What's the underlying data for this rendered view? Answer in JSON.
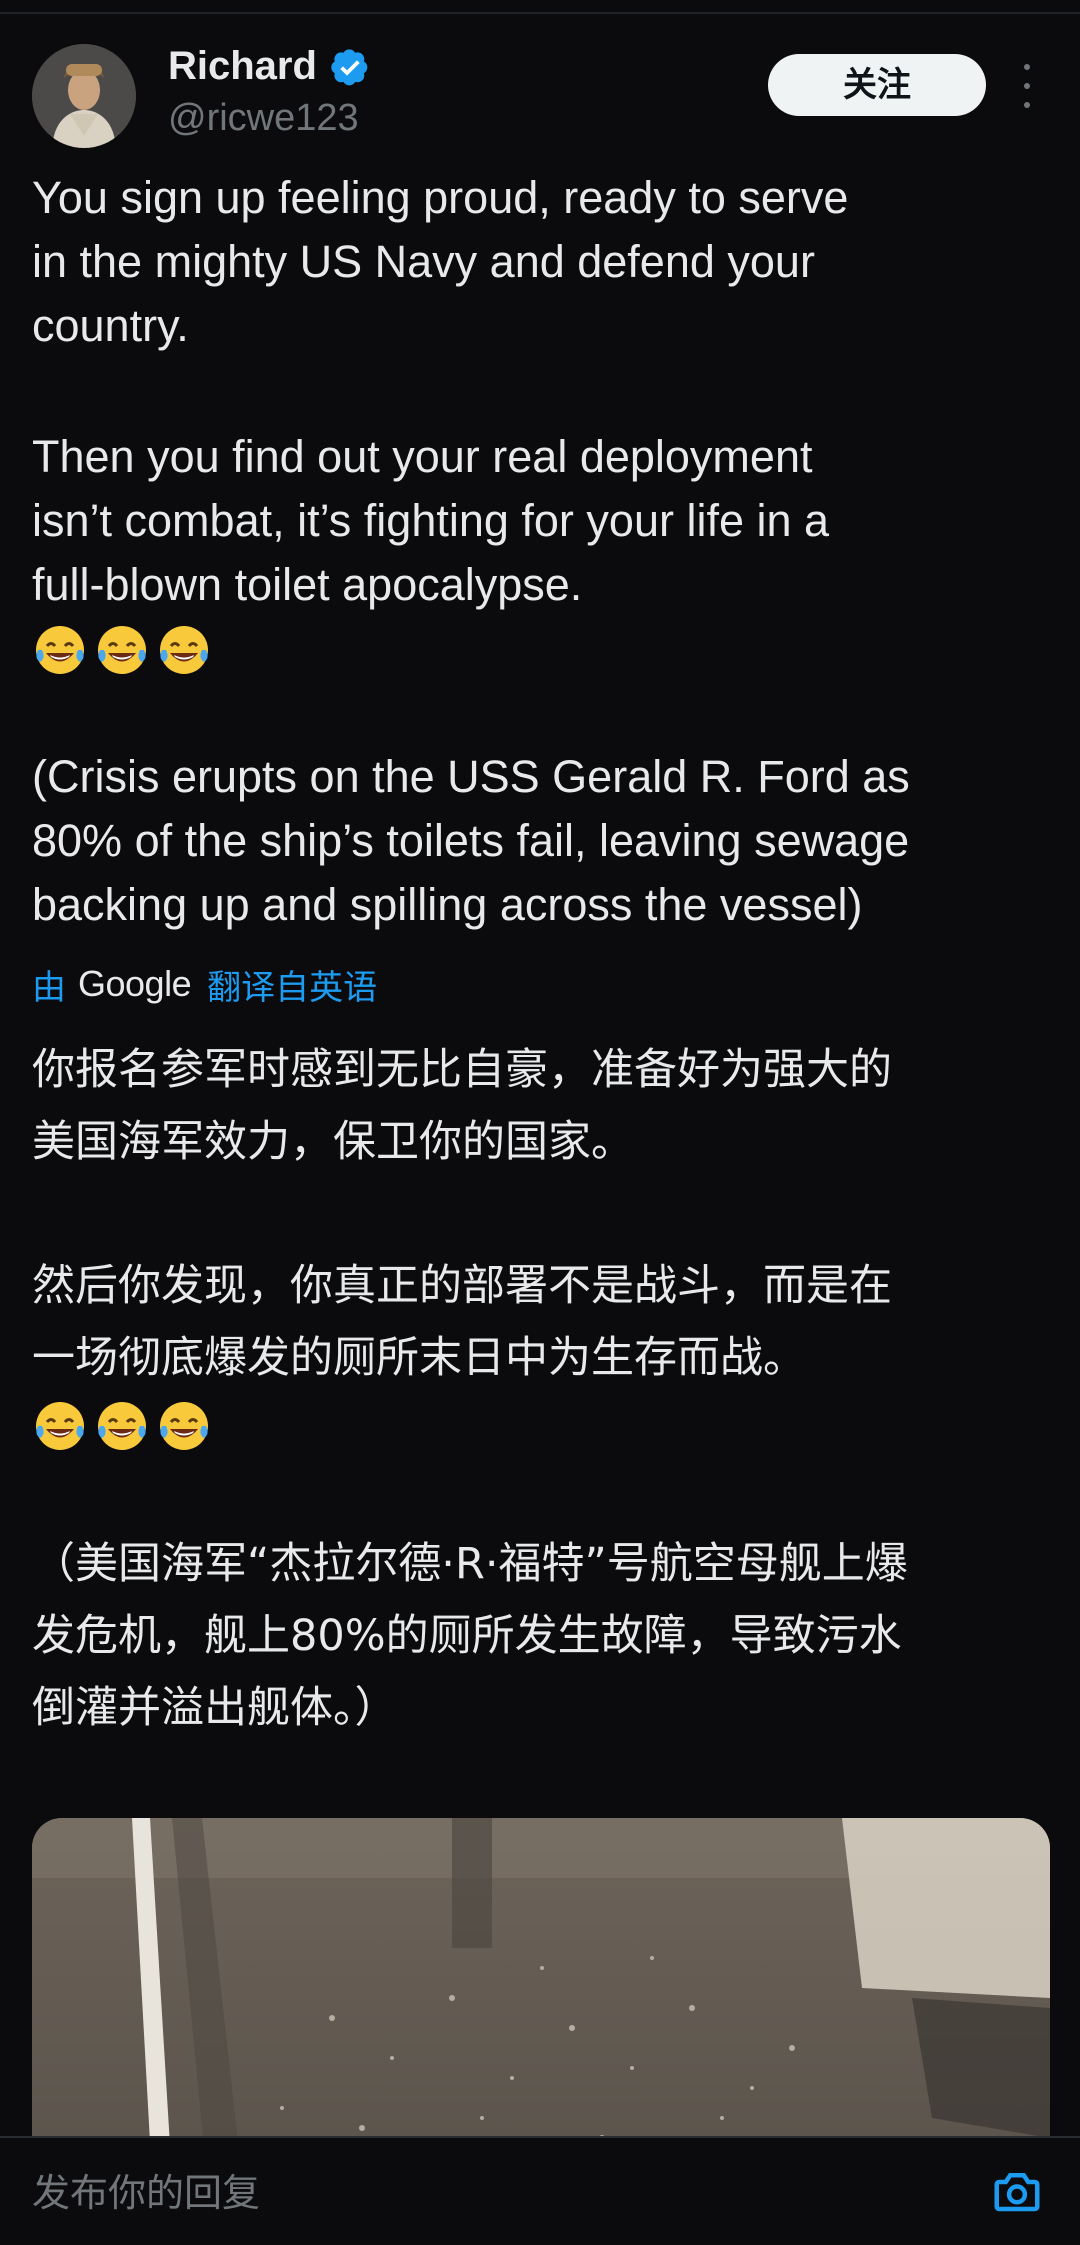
{
  "header": {
    "display_name": "Richard",
    "handle": "@ricwe123",
    "follow_label": "关注",
    "verified_icon": "verified-badge-icon",
    "more_icon": "more-vertical-icon"
  },
  "post": {
    "en_paragraph_1": "You sign up feeling proud, ready to serve\nin the mighty US Navy and defend your\ncountry.",
    "en_paragraph_2": "Then you find out your real deployment\nisn’t combat, it’s fighting for your life in a\nfull-blown toilet apocalypse.",
    "en_paragraph_3": "(Crisis erupts on the USS Gerald R. Ford as\n80% of the ship’s toilets fail, leaving sewage\nbacking up and spilling across the vessel)",
    "emoji_icon": "face-with-tears-of-joy-icon"
  },
  "translation": {
    "by_label": "由",
    "provider": "Google",
    "from_label": "翻译自英语",
    "zh_paragraph_1": "你报名参军时感到无比自豪，准备好为强大的\n美国海军效力，保卫你的国家。",
    "zh_paragraph_2": "然后你发现，你真正的部署不是战斗，而是在\n一场彻底爆发的厕所末日中为生存而战。",
    "zh_paragraph_3": "（美国海军“杰拉尔德·R·福特”号航空母舰上爆\n发危机，舰上80%的厕所发生故障，导致污水\n倒灌并溢出舰体。）"
  },
  "reply_bar": {
    "placeholder": "发布你的回复",
    "camera_icon": "camera-icon"
  },
  "colors": {
    "background": "#0b0b0d",
    "text": "#e7e9ea",
    "secondary_text": "#71767b",
    "accent": "#1d9bf0",
    "follow_button_bg": "#eff3f4"
  }
}
